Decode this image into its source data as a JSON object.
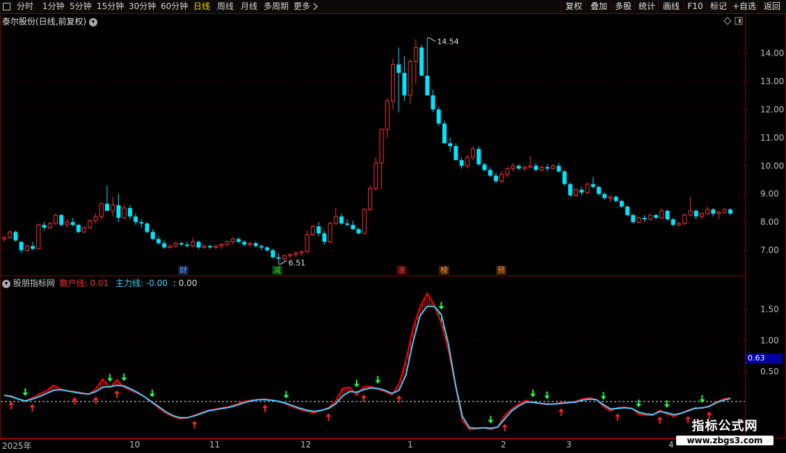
{
  "toolbar": {
    "periods": [
      "分时",
      "1分钟",
      "5分钟",
      "15分钟",
      "30分钟",
      "60分钟",
      "日线",
      "周线",
      "月线",
      "多周期",
      "更多"
    ],
    "active_period": "日线",
    "more_icon": "chevron-right-icon",
    "buttons": [
      "复权",
      "叠加",
      "多股",
      "统计",
      "画线",
      "F10",
      "标记",
      "+自选",
      "返回"
    ]
  },
  "main_panel": {
    "title": "泰尔股份(日线,前复权)",
    "title_icon": "chevron-down-circle-icon",
    "right_icons": [
      "diamond-icon",
      "panel-toggle-icon"
    ],
    "high_label": "14.54",
    "low_label": "6.51",
    "badges": [
      {
        "text": "财",
        "color": "#6fa8ff"
      },
      {
        "text": "减",
        "color": "#3ad33a"
      },
      {
        "text": "涨",
        "color": "#ff4040"
      },
      {
        "text": "榜",
        "color": "#ff9a3c"
      },
      {
        "text": "预",
        "color": "#ff9a3c"
      }
    ]
  },
  "indicator_panel": {
    "name": "股朋指标网",
    "line1_label": "散户线:",
    "line1_value": "0.01",
    "line2_label": "主力线:",
    "line2_value": "-0.00",
    "line3_label": ":",
    "line3_value": "0.00",
    "current_value_tag": "0.63"
  },
  "time_axis": [
    "2025年",
    "10",
    "11",
    "12",
    "1",
    "2",
    "3",
    "4"
  ],
  "watermark": {
    "line1": "指标公式网",
    "line2": "www.zbgs3.com"
  },
  "colors": {
    "up": "#ff3030",
    "down": "#00e5ff",
    "grid": "#5a0000",
    "retail_line": "#ff0000",
    "main_line": "#3fd0ff",
    "fill_up": "#ff1010",
    "fill_down": "#00ff40",
    "accent": "#ffd200"
  },
  "chart_data": [
    {
      "type": "candlestick",
      "title": "泰尔股份(日线,前复权)",
      "y_ticks": [
        7.0,
        8.0,
        9.0,
        10.0,
        11.0,
        12.0,
        13.0,
        14.0
      ],
      "ylim": [
        6.2,
        14.9
      ],
      "annotations": [
        {
          "text": "14.54",
          "kind": "high"
        },
        {
          "text": "6.51",
          "kind": "low"
        }
      ],
      "ohlc": [
        [
          7.4,
          7.5,
          7.3,
          7.45
        ],
        [
          7.45,
          7.7,
          7.4,
          7.65
        ],
        [
          7.65,
          7.7,
          7.3,
          7.35
        ],
        [
          7.3,
          7.3,
          6.9,
          7.0
        ],
        [
          7.0,
          7.2,
          6.95,
          7.15
        ],
        [
          7.15,
          7.3,
          7.0,
          7.05
        ],
        [
          7.05,
          7.95,
          7.05,
          7.9
        ],
        [
          7.9,
          8.0,
          7.7,
          7.8
        ],
        [
          7.8,
          8.0,
          7.75,
          7.95
        ],
        [
          7.95,
          8.3,
          7.9,
          8.25
        ],
        [
          8.25,
          8.3,
          7.85,
          7.9
        ],
        [
          7.9,
          8.1,
          7.8,
          8.0
        ],
        [
          8.0,
          8.15,
          7.85,
          7.9
        ],
        [
          7.9,
          7.95,
          7.6,
          7.65
        ],
        [
          7.65,
          7.85,
          7.6,
          7.8
        ],
        [
          7.8,
          8.1,
          7.75,
          8.05
        ],
        [
          8.05,
          8.3,
          7.95,
          8.2
        ],
        [
          8.2,
          8.7,
          8.1,
          8.65
        ],
        [
          8.65,
          9.3,
          8.45,
          8.4
        ],
        [
          8.4,
          8.9,
          8.2,
          8.6
        ],
        [
          8.6,
          9.0,
          8.0,
          8.15
        ],
        [
          8.15,
          8.6,
          8.1,
          8.5
        ],
        [
          8.5,
          8.6,
          8.1,
          8.2
        ],
        [
          8.2,
          8.3,
          7.9,
          8.0
        ],
        [
          8.0,
          8.1,
          7.8,
          7.95
        ],
        [
          7.95,
          8.0,
          7.6,
          7.65
        ],
        [
          7.65,
          7.75,
          7.35,
          7.4
        ],
        [
          7.4,
          7.5,
          7.2,
          7.25
        ],
        [
          7.25,
          7.35,
          7.05,
          7.1
        ],
        [
          7.1,
          7.2,
          7.05,
          7.15
        ],
        [
          7.15,
          7.3,
          7.1,
          7.25
        ],
        [
          7.25,
          7.3,
          7.15,
          7.2
        ],
        [
          7.2,
          7.3,
          7.1,
          7.15
        ],
        [
          7.15,
          7.45,
          7.1,
          7.3
        ],
        [
          7.3,
          7.35,
          7.05,
          7.1
        ],
        [
          7.1,
          7.2,
          7.05,
          7.15
        ],
        [
          7.15,
          7.2,
          7.05,
          7.1
        ],
        [
          7.1,
          7.2,
          7.05,
          7.15
        ],
        [
          7.15,
          7.25,
          7.05,
          7.2
        ],
        [
          7.2,
          7.35,
          7.15,
          7.3
        ],
        [
          7.3,
          7.45,
          7.2,
          7.4
        ],
        [
          7.4,
          7.45,
          7.25,
          7.3
        ],
        [
          7.3,
          7.35,
          7.15,
          7.2
        ],
        [
          7.2,
          7.3,
          7.1,
          7.25
        ],
        [
          7.25,
          7.3,
          7.1,
          7.15
        ],
        [
          7.15,
          7.2,
          7.0,
          7.1
        ],
        [
          7.1,
          7.15,
          6.95,
          7.0
        ],
        [
          7.0,
          7.05,
          6.7,
          6.75
        ],
        [
          6.75,
          6.9,
          6.51,
          6.7
        ],
        [
          6.7,
          6.85,
          6.6,
          6.8
        ],
        [
          6.8,
          6.9,
          6.7,
          6.85
        ],
        [
          6.85,
          6.95,
          6.75,
          6.9
        ],
        [
          6.9,
          7.0,
          6.8,
          6.95
        ],
        [
          6.95,
          7.7,
          6.9,
          7.55
        ],
        [
          7.55,
          7.9,
          7.5,
          7.85
        ],
        [
          7.85,
          8.0,
          7.5,
          7.6
        ],
        [
          7.6,
          7.7,
          7.2,
          7.3
        ],
        [
          7.3,
          8.0,
          7.25,
          7.95
        ],
        [
          7.95,
          8.5,
          7.9,
          8.2
        ],
        [
          8.2,
          8.3,
          7.9,
          7.95
        ],
        [
          7.95,
          8.1,
          7.85,
          7.9
        ],
        [
          7.9,
          8.05,
          7.7,
          7.75
        ],
        [
          7.75,
          7.8,
          7.55,
          7.6
        ],
        [
          7.6,
          8.5,
          7.55,
          8.45
        ],
        [
          8.45,
          9.3,
          8.4,
          9.2
        ],
        [
          9.2,
          10.3,
          9.1,
          10.1
        ],
        [
          10.1,
          11.3,
          9.2,
          11.3
        ],
        [
          11.3,
          12.4,
          11.0,
          12.3
        ],
        [
          12.3,
          13.8,
          12.0,
          13.6
        ],
        [
          13.6,
          14.2,
          11.9,
          13.3
        ],
        [
          13.3,
          13.9,
          12.3,
          12.5
        ],
        [
          12.5,
          13.8,
          12.2,
          13.7
        ],
        [
          13.7,
          14.5,
          12.9,
          14.2
        ],
        [
          14.2,
          14.3,
          13.5,
          13.2
        ],
        [
          13.2,
          14.54,
          12.8,
          12.5
        ],
        [
          12.5,
          12.7,
          11.9,
          12.0
        ],
        [
          12.0,
          12.1,
          11.4,
          11.5
        ],
        [
          11.5,
          11.6,
          10.8,
          10.8
        ],
        [
          10.8,
          11.0,
          10.5,
          10.7
        ],
        [
          10.7,
          10.8,
          10.2,
          10.2
        ],
        [
          10.2,
          10.3,
          9.9,
          10.0
        ],
        [
          10.0,
          10.4,
          9.9,
          10.3
        ],
        [
          10.3,
          10.7,
          10.2,
          10.6
        ],
        [
          10.6,
          10.7,
          10.0,
          10.05
        ],
        [
          10.05,
          10.1,
          9.8,
          9.85
        ],
        [
          9.85,
          9.95,
          9.6,
          9.65
        ],
        [
          9.65,
          9.75,
          9.4,
          9.45
        ],
        [
          9.45,
          9.8,
          9.4,
          9.7
        ],
        [
          9.7,
          9.95,
          9.6,
          9.9
        ],
        [
          9.9,
          10.1,
          9.8,
          10.0
        ],
        [
          10.0,
          10.05,
          9.85,
          9.9
        ],
        [
          9.9,
          10.0,
          9.8,
          9.95
        ],
        [
          9.95,
          10.35,
          9.9,
          10.0
        ],
        [
          10.0,
          10.1,
          9.8,
          9.85
        ],
        [
          9.85,
          10.0,
          9.8,
          9.95
        ],
        [
          9.95,
          10.05,
          9.8,
          9.9
        ],
        [
          9.9,
          10.05,
          9.85,
          10.0
        ],
        [
          10.0,
          10.1,
          9.75,
          9.8
        ],
        [
          9.8,
          9.85,
          9.3,
          9.35
        ],
        [
          9.35,
          9.4,
          8.9,
          8.95
        ],
        [
          8.95,
          9.2,
          8.9,
          9.15
        ],
        [
          9.15,
          9.25,
          8.95,
          9.05
        ],
        [
          9.05,
          9.4,
          9.0,
          9.35
        ],
        [
          9.35,
          9.6,
          9.2,
          9.25
        ],
        [
          9.25,
          9.3,
          8.95,
          9.0
        ],
        [
          9.0,
          9.05,
          8.8,
          8.85
        ],
        [
          8.85,
          8.95,
          8.7,
          8.9
        ],
        [
          8.9,
          8.95,
          8.7,
          8.75
        ],
        [
          8.75,
          8.8,
          8.5,
          8.55
        ],
        [
          8.55,
          8.6,
          8.2,
          8.25
        ],
        [
          8.25,
          8.3,
          7.95,
          8.0
        ],
        [
          8.0,
          8.2,
          7.95,
          8.15
        ],
        [
          8.15,
          8.25,
          8.0,
          8.1
        ],
        [
          8.1,
          8.3,
          8.05,
          8.25
        ],
        [
          8.25,
          8.3,
          8.1,
          8.15
        ],
        [
          8.15,
          8.5,
          8.1,
          8.4
        ],
        [
          8.4,
          8.45,
          8.05,
          8.1
        ],
        [
          8.1,
          8.15,
          7.85,
          7.9
        ],
        [
          7.9,
          8.0,
          7.85,
          7.95
        ],
        [
          7.95,
          8.3,
          7.9,
          8.25
        ],
        [
          8.25,
          8.9,
          8.2,
          8.4
        ],
        [
          8.4,
          8.45,
          8.1,
          8.2
        ],
        [
          8.2,
          8.35,
          8.1,
          8.3
        ],
        [
          8.3,
          8.55,
          8.25,
          8.45
        ],
        [
          8.45,
          8.5,
          8.2,
          8.3
        ],
        [
          8.3,
          8.4,
          8.1,
          8.35
        ],
        [
          8.35,
          8.5,
          8.3,
          8.45
        ],
        [
          8.45,
          8.5,
          8.25,
          8.3
        ]
      ]
    },
    {
      "type": "line",
      "title": "股朋指标网",
      "y_ticks": [
        0.5,
        1.0,
        1.5
      ],
      "ylim": [
        -0.55,
        2.0
      ],
      "series": [
        {
          "name": "散户线",
          "values": [
            0.12,
            0.11,
            0.06,
            0.02,
            0.08,
            0.14,
            0.19,
            0.28,
            0.22,
            0.19,
            0.18,
            0.16,
            0.14,
            0.22,
            0.38,
            0.24,
            0.37,
            0.25,
            0.2,
            0.15,
            0.09,
            0.0,
            -0.09,
            -0.17,
            -0.22,
            -0.26,
            -0.24,
            -0.2,
            -0.16,
            -0.12,
            -0.1,
            -0.08,
            -0.06,
            -0.02,
            0.02,
            0.04,
            0.05,
            0.06,
            0.04,
            0.02,
            -0.02,
            -0.07,
            -0.11,
            -0.14,
            -0.16,
            -0.12,
            -0.08,
            0.02,
            0.23,
            0.25,
            0.12,
            0.26,
            0.26,
            0.22,
            0.18,
            0.13,
            0.3,
            0.68,
            1.2,
            1.54,
            1.76,
            1.57,
            1.28,
            0.85,
            0.28,
            -0.28,
            -0.43,
            -0.42,
            -0.4,
            -0.43,
            -0.39,
            -0.2,
            -0.1,
            -0.02,
            0.04,
            0.0,
            -0.01,
            -0.03,
            -0.02,
            0.0,
            0.01,
            0.02,
            0.06,
            0.08,
            0.05,
            -0.06,
            -0.13,
            -0.08,
            -0.07,
            -0.09,
            -0.18,
            -0.2,
            -0.2,
            -0.12,
            -0.18,
            -0.22,
            -0.17,
            -0.12,
            -0.08,
            -0.09,
            -0.05,
            0.01,
            0.06,
            0.08
          ]
        },
        {
          "name": "主力线",
          "values": [
            0.12,
            0.1,
            0.06,
            0.03,
            0.06,
            0.1,
            0.15,
            0.2,
            0.21,
            0.19,
            0.17,
            0.15,
            0.14,
            0.18,
            0.25,
            0.26,
            0.28,
            0.27,
            0.22,
            0.16,
            0.09,
            0.01,
            -0.07,
            -0.15,
            -0.21,
            -0.24,
            -0.24,
            -0.21,
            -0.17,
            -0.13,
            -0.11,
            -0.09,
            -0.07,
            -0.04,
            0.0,
            0.03,
            0.05,
            0.05,
            0.04,
            0.02,
            -0.01,
            -0.05,
            -0.09,
            -0.12,
            -0.14,
            -0.12,
            -0.09,
            -0.02,
            0.11,
            0.18,
            0.17,
            0.21,
            0.24,
            0.23,
            0.2,
            0.15,
            0.2,
            0.45,
            0.98,
            1.4,
            1.55,
            1.55,
            1.42,
            0.95,
            0.3,
            -0.22,
            -0.4,
            -0.41,
            -0.4,
            -0.41,
            -0.39,
            -0.26,
            -0.13,
            -0.05,
            0.01,
            0.01,
            -0.01,
            -0.02,
            -0.02,
            -0.01,
            0.0,
            0.01,
            0.04,
            0.06,
            0.05,
            -0.03,
            -0.1,
            -0.09,
            -0.08,
            -0.09,
            -0.15,
            -0.18,
            -0.19,
            -0.14,
            -0.16,
            -0.19,
            -0.17,
            -0.13,
            -0.09,
            -0.08,
            -0.06,
            0.0,
            0.04,
            0.07
          ]
        }
      ]
    }
  ]
}
